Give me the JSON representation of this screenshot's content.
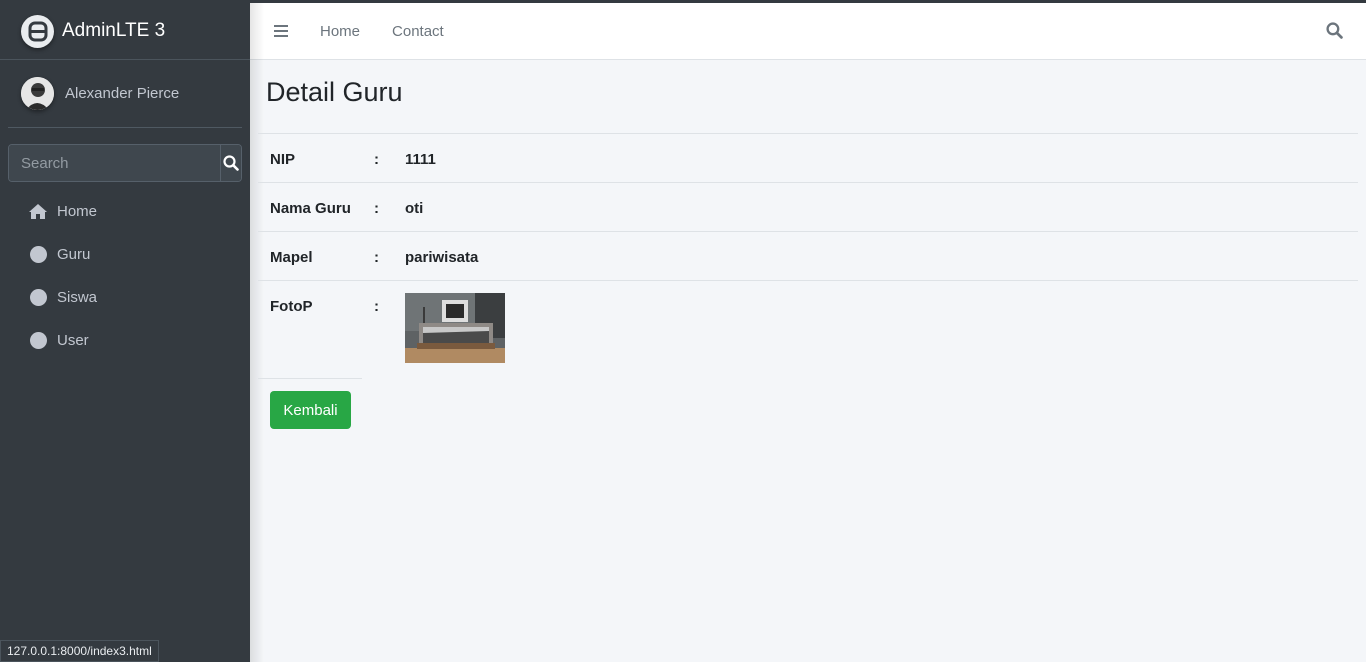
{
  "brand": {
    "title": "AdminLTE 3",
    "logo_icon": "adminlte-logo-icon"
  },
  "user": {
    "name": "Alexander Pierce",
    "avatar_icon": "user-avatar"
  },
  "sidebar": {
    "search": {
      "placeholder": "Search",
      "value": ""
    },
    "items": [
      {
        "label": "Home",
        "icon": "home-icon"
      },
      {
        "label": "Guru",
        "icon": "circle-icon"
      },
      {
        "label": "Siswa",
        "icon": "circle-icon"
      },
      {
        "label": "User",
        "icon": "circle-icon"
      }
    ]
  },
  "topbar": {
    "links": [
      {
        "label": "Home"
      },
      {
        "label": "Contact"
      }
    ],
    "search_icon": "search-icon",
    "menu_icon": "hamburger-icon"
  },
  "main": {
    "title": "Detail Guru",
    "rows": [
      {
        "label": "NIP",
        "colon": ":",
        "value": "1111"
      },
      {
        "label": "Nama Guru",
        "colon": ":",
        "value": "oti"
      },
      {
        "label": "Mapel",
        "colon": ":",
        "value": "pariwisata"
      }
    ],
    "photo_row": {
      "label": "FotoP",
      "colon": ":"
    },
    "back_button": "Kembali"
  },
  "status_bar": {
    "url": "127.0.0.1:8000/index3.html"
  },
  "colors": {
    "sidebar_bg": "#343a40",
    "content_bg": "#f4f6f9",
    "button_success": "#28a745"
  }
}
